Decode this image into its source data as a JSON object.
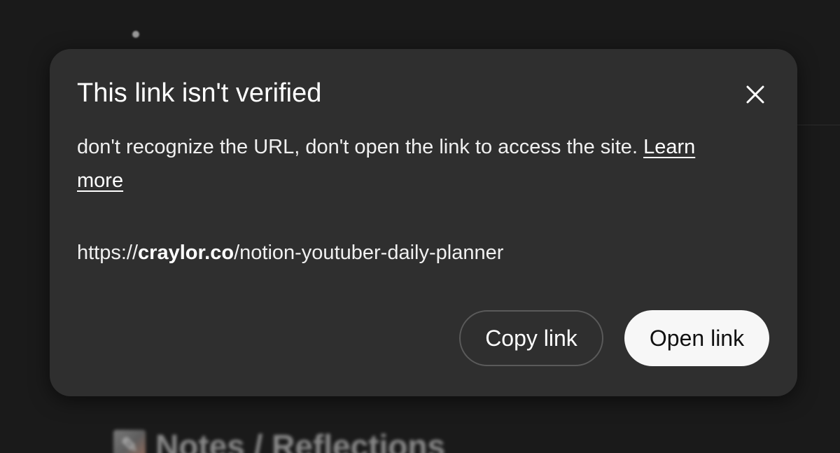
{
  "background": {
    "heading_icon": "memo-icon",
    "heading_text": "Notes / Reflections"
  },
  "dialog": {
    "title": "This link isn't verified",
    "close_icon": "close-icon",
    "body_text": "don't recognize the URL, don't open the link to access the site.",
    "learn_more_label": "Learn more",
    "url": {
      "scheme": "https://",
      "host": "craylor.co",
      "path": "/notion-youtuber-daily-planner"
    },
    "copy_link_label": "Copy link",
    "open_link_label": "Open link"
  },
  "colors": {
    "backdrop": "#1a1a1a",
    "dialog_background": "#2f2f2f",
    "primary_button_background": "#f7f7f7",
    "secondary_button_border": "#5a5a5a",
    "text": "#ffffff"
  }
}
